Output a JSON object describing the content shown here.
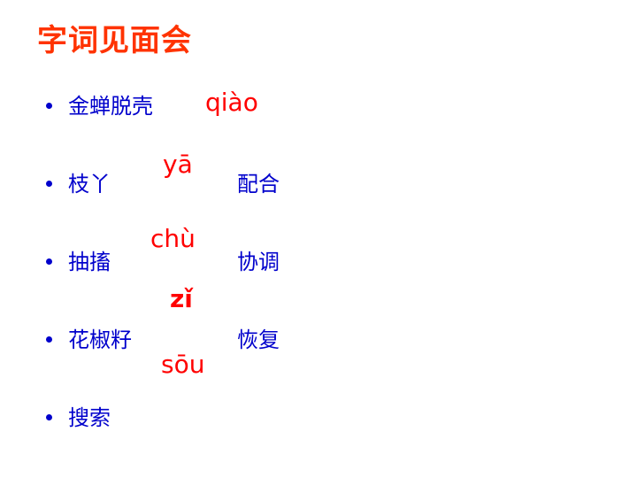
{
  "slide": {
    "title": "字词见面会"
  },
  "bullets": [
    "金蝉脱壳",
    "枝丫",
    "抽搐",
    "花椒籽",
    "搜索"
  ],
  "pinyin": [
    "qiào",
    "yā",
    "chù",
    "zǐ",
    "sōu"
  ],
  "words": [
    "配合",
    "协调",
    "恢复"
  ],
  "colors": {
    "title": "#ff3300",
    "body_text": "#0000cc",
    "pinyin": "#ff0000"
  }
}
